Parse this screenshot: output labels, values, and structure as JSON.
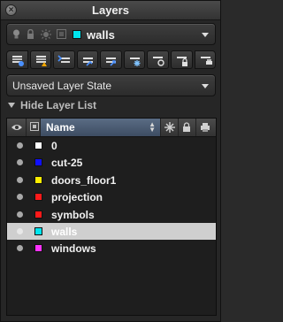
{
  "window": {
    "title": "Layers",
    "close_glyph": "×"
  },
  "current_layer": {
    "name": "walls",
    "color": "#00e5ee",
    "icons": [
      "lightbulb-icon",
      "lock-icon",
      "sun-icon"
    ]
  },
  "toolbar": {
    "buttons": [
      "new-layer-icon",
      "freeze-layer-icon",
      "isolate-layer-icon",
      "match-layer-icon",
      "previous-layer-icon",
      "freeze-vp-icon",
      "off-layer-icon",
      "lock-layer-icon",
      "plot-layer-icon"
    ]
  },
  "layer_state": {
    "value": "Unsaved Layer State"
  },
  "hide_list": {
    "label": "Hide Layer List"
  },
  "list": {
    "header": {
      "name": "Name"
    },
    "rows": [
      {
        "name": "0",
        "color": "#ffffff",
        "selected": false
      },
      {
        "name": "cut-25",
        "color": "#1010ff",
        "selected": false
      },
      {
        "name": "doors_floor1",
        "color": "#ffee00",
        "selected": false
      },
      {
        "name": "projection",
        "color": "#ff1a1a",
        "selected": false
      },
      {
        "name": "symbols",
        "color": "#ff1a1a",
        "selected": false
      },
      {
        "name": "walls",
        "color": "#00e5ee",
        "selected": true
      },
      {
        "name": "windows",
        "color": "#ff33ff",
        "selected": false
      }
    ]
  }
}
